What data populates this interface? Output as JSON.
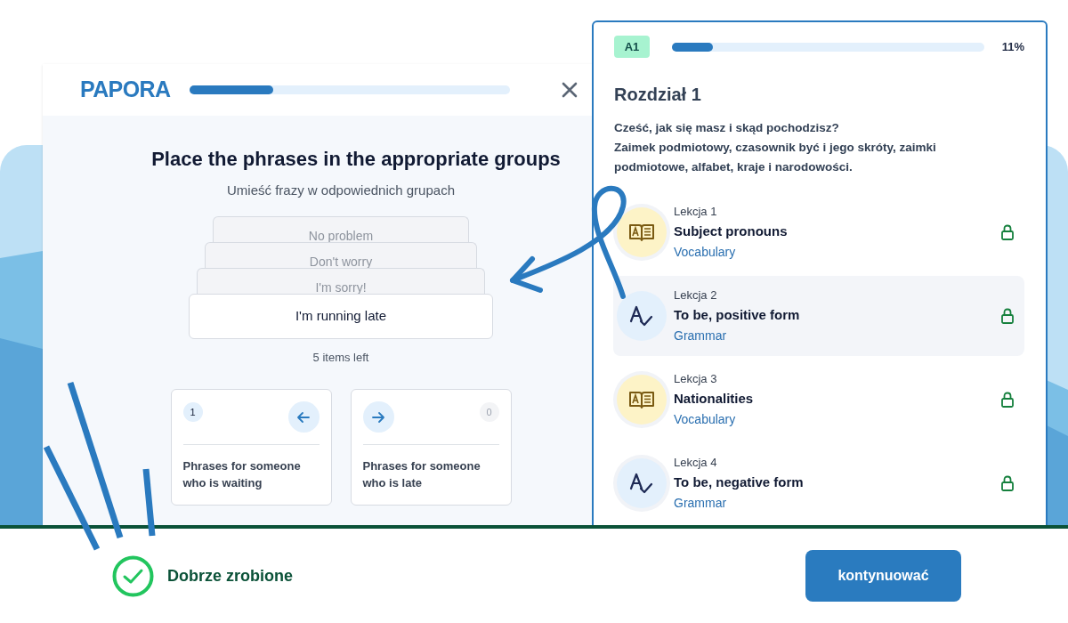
{
  "exercise": {
    "logo": "PAPORA",
    "progress": {
      "level": 0.26
    },
    "title": "Place the phrases in the appropriate groups",
    "subtitle": "Umieść frazy w odpowiednich grupach",
    "cards": [
      {
        "text": "No problem",
        "kind": "stacked"
      },
      {
        "text": "Don't worry",
        "kind": "stacked"
      },
      {
        "text": "I'm sorry!",
        "kind": "stacked"
      },
      {
        "text": "I'm running late",
        "kind": "current"
      }
    ],
    "items_left": "5 items left",
    "groups": [
      {
        "count": "1",
        "kind": "left",
        "highlighted": true,
        "label": "Phrases for someone who is waiting"
      },
      {
        "count": "0",
        "kind": "right",
        "highlighted": false,
        "label": "Phrases for someone who is late"
      }
    ]
  },
  "chapter": {
    "level_badge": "A1",
    "progress": {
      "level": 0.13
    },
    "percent": "11%",
    "title": "Rozdział 1",
    "description": [
      "Cześć, jak się masz i skąd pochodzisz?",
      "Zaimek podmiotowy, czasownik być i jego skróty, zaimki podmiotowe, alfabet, kraje i narodowości."
    ],
    "lessons": [
      {
        "number": "Lekcja 1",
        "title": "Subject pronouns",
        "category": "Vocabulary",
        "kind": "vocabulary",
        "selected": false,
        "locked": true
      },
      {
        "number": "Lekcja 2",
        "title": "To be, positive form",
        "category": "Grammar",
        "kind": "grammar",
        "selected": true,
        "locked": true
      },
      {
        "number": "Lekcja 3",
        "title": "Nationalities",
        "category": "Vocabulary",
        "kind": "vocabulary",
        "selected": false,
        "locked": true
      },
      {
        "number": "Lekcja 4",
        "title": "To be, negative form",
        "category": "Grammar",
        "kind": "grammar",
        "selected": false,
        "locked": true
      }
    ]
  },
  "feedback": {
    "message": "Dobrze zrobione",
    "button": "kontynuować"
  }
}
